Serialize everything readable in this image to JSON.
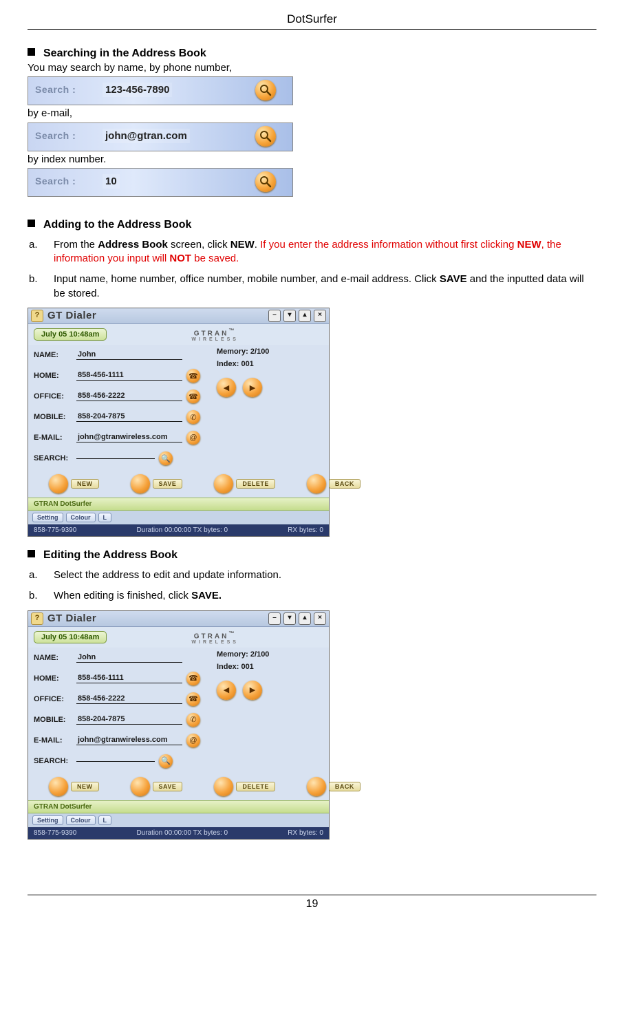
{
  "header": {
    "title": "DotSurfer"
  },
  "footer": {
    "page_number": "19"
  },
  "section_searching": {
    "heading": "Searching in the Address Book",
    "intro": "You may search by name, by phone number,",
    "by_email_text": "by e-mail,",
    "by_index_text": "by index number.",
    "search_label": "Search :",
    "bar1_value": "123-456-7890",
    "bar2_value": "john@gtran.com",
    "bar3_value": "10"
  },
  "section_adding": {
    "heading": "Adding to the Address Book",
    "a_marker": "a.",
    "a_text_1": "From the ",
    "a_bold_1": "Address Book",
    "a_text_2": " screen, click ",
    "a_bold_2": "NEW",
    "a_text_3": ". ",
    "a_red_1": "If you enter the address information without first clicking ",
    "a_red_bold_1": "NEW",
    "a_red_2": ", the information you input will ",
    "a_red_bold_2": "NOT",
    "a_red_3": " be saved.",
    "b_marker": "b.",
    "b_text_1": "Input name, home number, office number, mobile number, and e-mail address. Click ",
    "b_bold_1": "SAVE",
    "b_text_2": " and the inputted data will be stored."
  },
  "section_editing": {
    "heading": "Editing the Address Book",
    "a_marker": "a.",
    "a_text": "Select the address to edit and update information.",
    "b_marker": "b.",
    "b_text_1": "When editing is finished, click ",
    "b_bold_1": "SAVE."
  },
  "dialer": {
    "help": "?",
    "title": "GT Dialer",
    "win_min": "–",
    "win_down": "▾",
    "win_up": "▴",
    "win_close": "×",
    "time_chip": "July 05    10:48am",
    "brand_top": "GTRAN",
    "brand_tm": "™",
    "brand_sub": "WIRELESS",
    "labels": {
      "name": "NAME:",
      "home": "HOME:",
      "office": "OFFICE:",
      "mobile": "MOBILE:",
      "email": "E-MAIL:",
      "search": "SEARCH:"
    },
    "values": {
      "name": "John",
      "home": "858-456-1111",
      "office": "858-456-2222",
      "mobile": "858-204-7875",
      "email": "john@gtranwireless.com",
      "search": ""
    },
    "memory": "Memory: 2/100",
    "index": "Index:     001",
    "buttons": {
      "new": "NEW",
      "save": "SAVE",
      "delete": "DELETE",
      "back": "BACK"
    },
    "marquee": "GTRAN DotSurfer",
    "bottom": {
      "setting": "Setting",
      "colour": "Colour",
      "lang": "L"
    },
    "status": {
      "left": "858-775-9390",
      "center": "Duration  00:00:00  TX bytes: 0",
      "right": "RX bytes: 0"
    }
  }
}
